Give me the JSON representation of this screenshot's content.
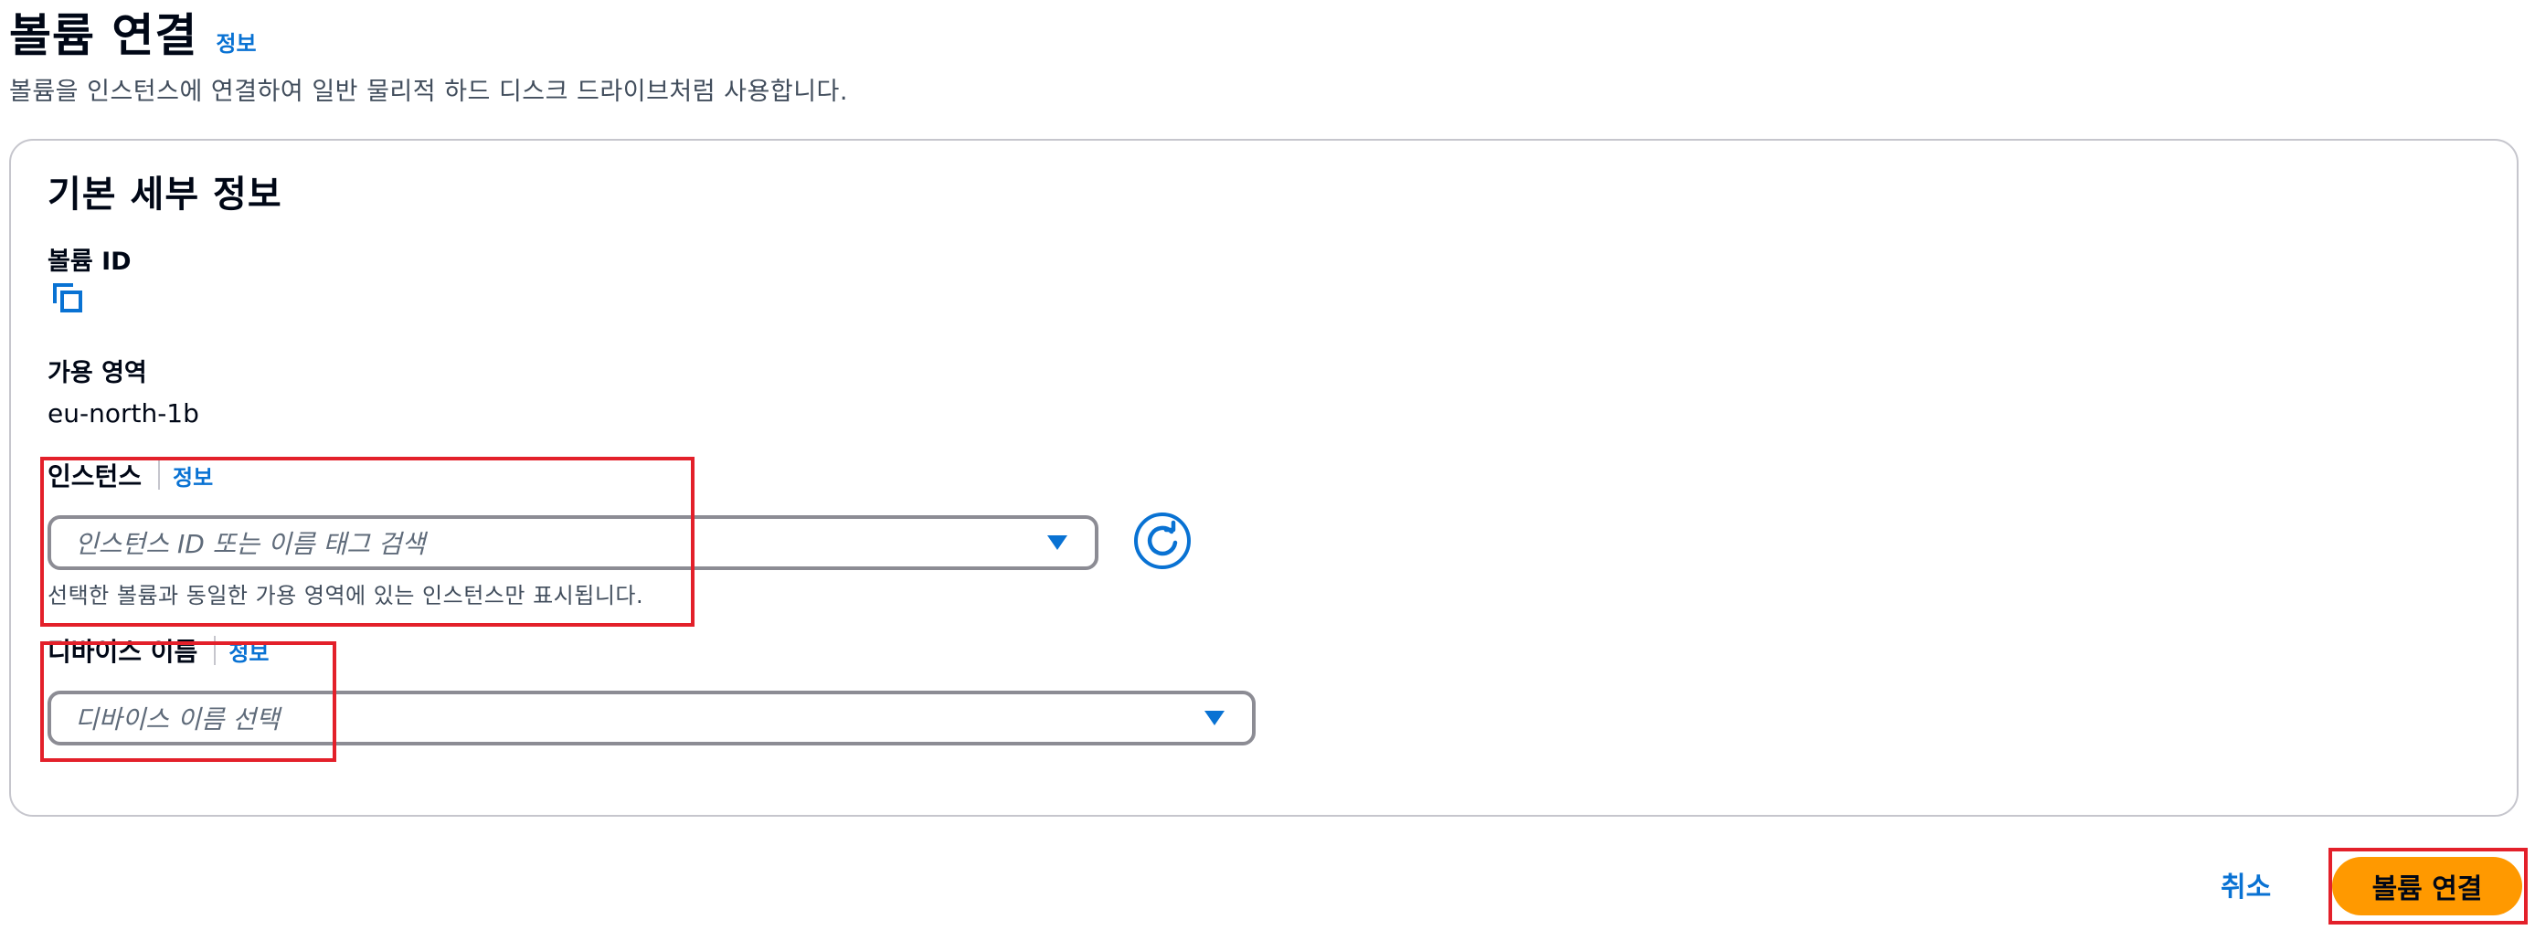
{
  "header": {
    "title": "볼륨 연결",
    "info_link": "정보",
    "description": "볼륨을 인스턴스에 연결하여 일반 물리적 하드 디스크 드라이브처럼 사용합니다."
  },
  "basic_details": {
    "title": "기본 세부 정보",
    "volume_id_label": "볼륨 ID",
    "volume_id_value": "",
    "availability_zone_label": "가용 영역",
    "availability_zone_value": "eu-north-1b",
    "instance": {
      "label": "인스턴스",
      "info_link": "정보",
      "placeholder": "인스턴스 ID 또는 이름 태그 검색",
      "hint": "선택한 볼륨과 동일한 가용 영역에 있는 인스턴스만 표시됩니다."
    },
    "device": {
      "label": "디바이스 이름",
      "info_link": "정보",
      "placeholder": "디바이스 이름 선택"
    }
  },
  "footer": {
    "cancel_label": "취소",
    "submit_label": "볼륨 연결"
  },
  "icons": {
    "copy": "copy-icon",
    "refresh": "refresh-icon",
    "dropdown": "caret-down-icon"
  },
  "colors": {
    "link": "#0972d3",
    "primary_button": "#ff9900",
    "highlight_box": "#e3202a",
    "border": "#8c8c94"
  }
}
